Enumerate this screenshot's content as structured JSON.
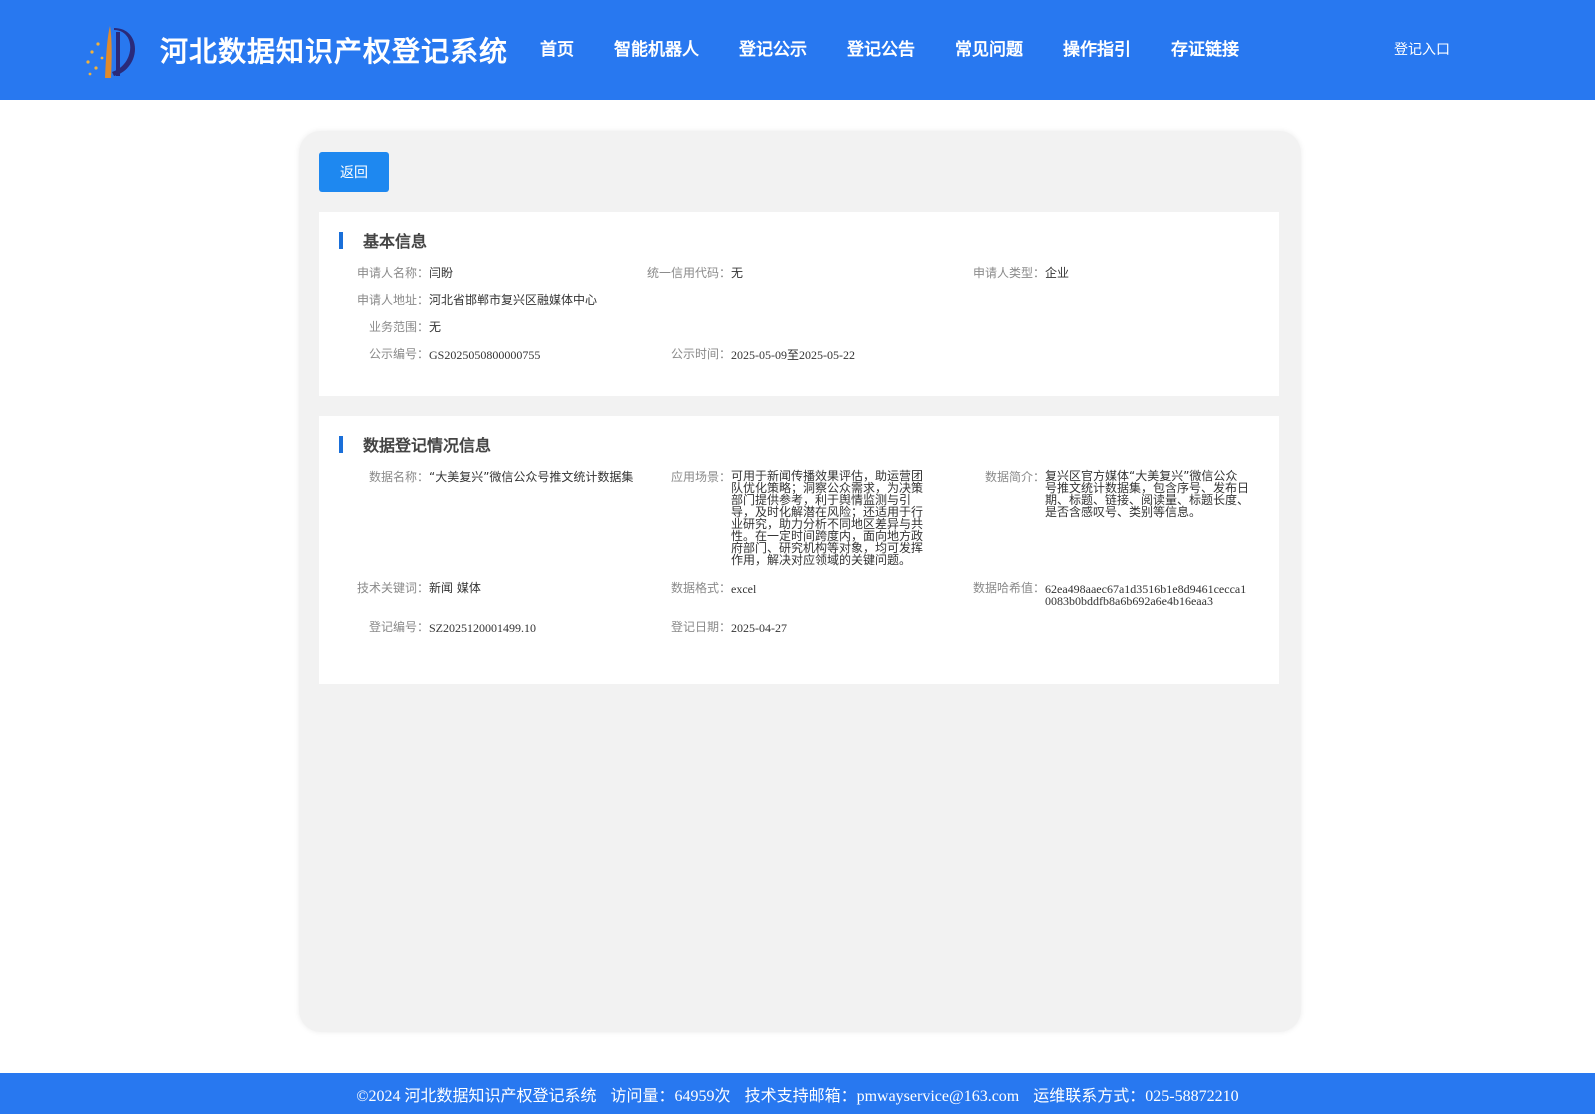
{
  "header": {
    "site_title": "河北数据知识产权登记系统",
    "nav": [
      "首页",
      "智能机器人",
      "登记公示",
      "登记公告",
      "常见问题",
      "操作指引",
      "存证链接"
    ],
    "login": "登记入口"
  },
  "back_label": "返回",
  "basic": {
    "title": "基本信息",
    "applicant_name": {
      "label": "申请人名称：",
      "value": "闫盼"
    },
    "credit_code": {
      "label": "统一信用代码：",
      "value": "无"
    },
    "applicant_type": {
      "label": "申请人类型：",
      "value": "企业"
    },
    "address": {
      "label": "申请人地址：",
      "value": "河北省邯郸市复兴区融媒体中心"
    },
    "business_scope": {
      "label": "业务范围：",
      "value": "无"
    },
    "notice_no": {
      "label": "公示编号：",
      "value": "GS2025050800000755"
    },
    "notice_time": {
      "label": "公示时间：",
      "value": "2025-05-09至2025-05-22"
    }
  },
  "data": {
    "title": "数据登记情况信息",
    "data_name": {
      "label": "数据名称：",
      "value": "“大美复兴”微信公众号推文统计数据集"
    },
    "scenario": {
      "label": "应用场景：",
      "value": "可用于新闻传播效果评估，助运营团队优化策略；洞察公众需求，为决策部门提供参考，利于舆情监测与引导，及时化解潜在风险；还适用于行业研究，助力分析不同地区差异与共性。在一定时间跨度内，面向地方政府部门、研究机构等对象，均可发挥作用，解决对应领域的关键问题。"
    },
    "summary": {
      "label": "数据简介：",
      "value": "复兴区官方媒体“大美复兴”微信公众号推文统计数据集，包含序号、发布日期、标题、链接、阅读量、标题长度、是否含感叹号、类别等信息。"
    },
    "keywords": {
      "label": "技术关键词：",
      "value": "新闻 媒体"
    },
    "format": {
      "label": "数据格式：",
      "value": "excel"
    },
    "hash": {
      "label": "数据哈希值：",
      "value": "62ea498aaec67a1d3516b1e8d9461cecca10083b0bddfb8a6b692a6e4b16eaa3"
    },
    "reg_no": {
      "label": "登记编号：",
      "value": "SZ2025120001499.10"
    },
    "reg_date": {
      "label": "登记日期：",
      "value": "2025-04-27"
    }
  },
  "footer": {
    "copyright": "©2024 河北数据知识产权登记系统",
    "visits": "访问量：64959次",
    "email": "技术支持邮箱：pmwayservice@163.com",
    "phone": "运维联系方式：025-58872210"
  }
}
